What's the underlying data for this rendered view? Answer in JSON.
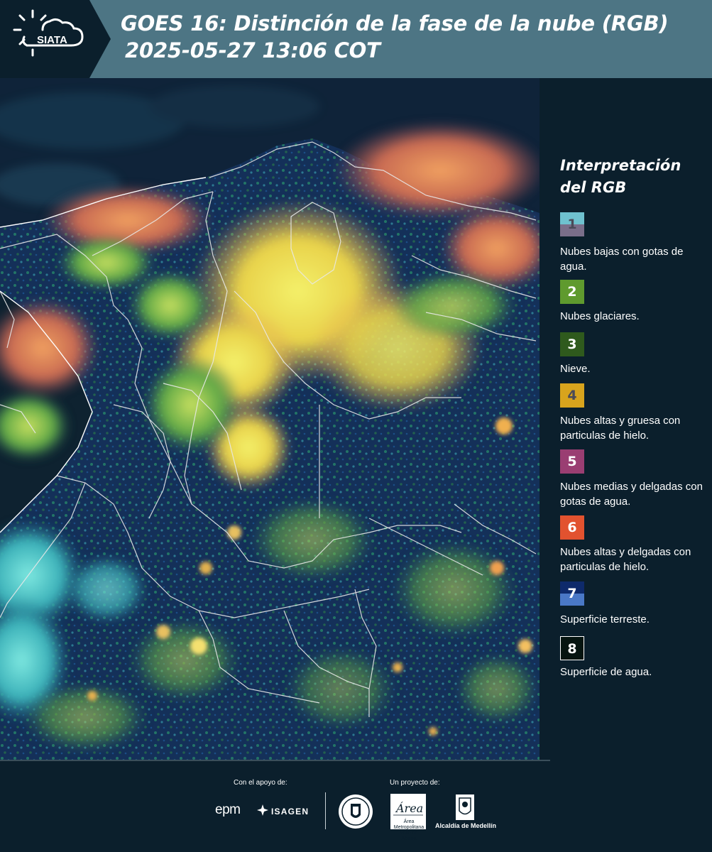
{
  "header": {
    "logo_text": "SIATA",
    "title_line1": "GOES 16: Distinción de la fase de la nube (RGB)",
    "title_line2": "2025-05-27 13:06 COT",
    "background_color": "#4d7584"
  },
  "legend": {
    "title": "Interpretación del RGB",
    "items": [
      {
        "number": "1",
        "label": "Nubes bajas con gotas de agua.",
        "color_top": "#6fc1cf",
        "color_bottom": "#7a6e8a",
        "text_color": "#4a4a58"
      },
      {
        "number": "2",
        "label": "Nubes glaciares.",
        "color_top": "#5f9a2e",
        "color_bottom": "#5f9a2e",
        "text_color": "#ffffff"
      },
      {
        "number": "3",
        "label": "Nieve.",
        "color_top": "#2f5a1d",
        "color_bottom": "#2f5a1d",
        "text_color": "#ffffff"
      },
      {
        "number": "4",
        "label": "Nubes altas y gruesa con particulas de hielo.",
        "color_top": "#d8a41d",
        "color_bottom": "#d8a41d",
        "text_color": "#4a4a58"
      },
      {
        "number": "5",
        "label": "Nubes medias y delgadas con gotas de agua.",
        "color_top": "#9a3e72",
        "color_bottom": "#9a3e72",
        "text_color": "#ffffff"
      },
      {
        "number": "6",
        "label": "Nubes altas y delgadas con particulas de hielo.",
        "color_top": "#e2522f",
        "color_bottom": "#e2522f",
        "text_color": "#ffffff"
      },
      {
        "number": "7",
        "label": "Superficie terreste.",
        "color_top": "#0e2a6b",
        "color_bottom": "#4a78c6",
        "text_color": "#ffffff"
      },
      {
        "number": "8",
        "label": "Superficie de agua.",
        "color_top": "#061410",
        "color_bottom": "#061410",
        "text_color": "#ffffff"
      }
    ]
  },
  "footer": {
    "support_label": "Con el apoyo de:",
    "project_label": "Un proyecto de:",
    "sponsor_1": "epm",
    "sponsor_2": "ISAGEN",
    "partner_area": "Área Metropolitana Valle de Aburrá",
    "partner_alcaldia": "Alcaldía de Medellín"
  },
  "map": {
    "water_color": "#0f1e2b",
    "land_color": "#15305a",
    "border_color": "#e8e8e8"
  }
}
